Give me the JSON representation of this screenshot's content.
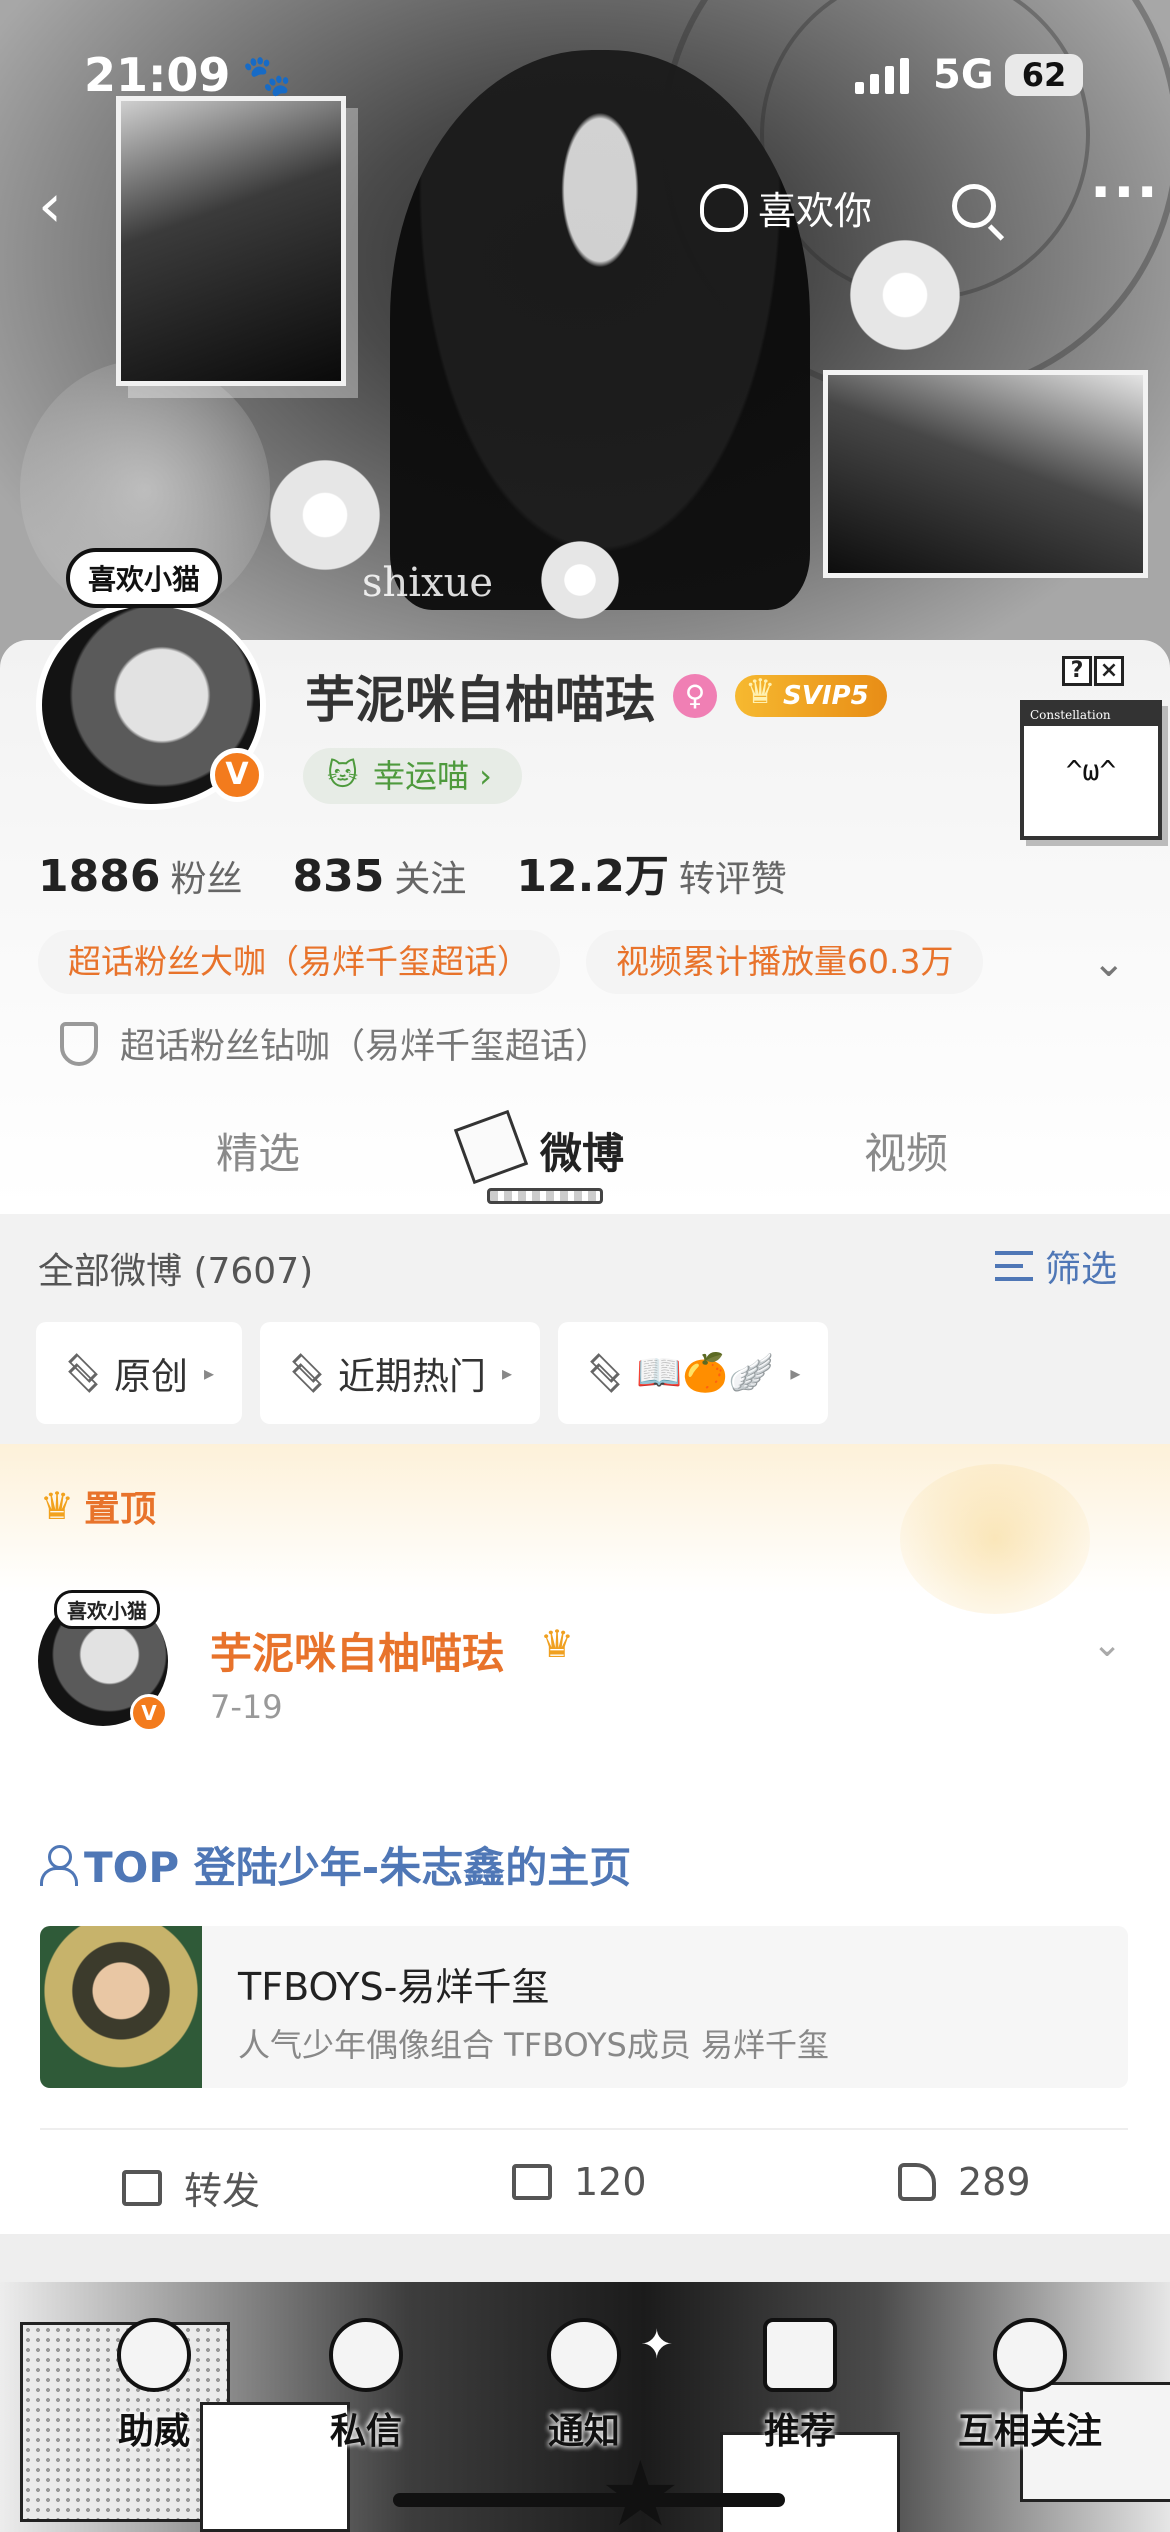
{
  "status_bar": {
    "time": "21:09",
    "network": "5G",
    "battery": "62"
  },
  "nav": {
    "like_label": "喜欢你"
  },
  "banner": {
    "watermark": "shixue"
  },
  "profile": {
    "avatar_bubble": "喜欢小猫",
    "verify_letter": "V",
    "name": "芋泥咪自柚喵珐",
    "svip_label": "SVIP5",
    "lucky_label": "幸运喵 ›",
    "widget_title": "Constellation",
    "widget_face": "^ω^",
    "stats": [
      {
        "num": "1886",
        "label": "粉丝"
      },
      {
        "num": "835",
        "label": "关注"
      },
      {
        "num": "12.2万",
        "label": "转评赞"
      }
    ],
    "tags": [
      "超话粉丝大咖（易烊千玺超话）",
      "视频累计播放量60.3万"
    ],
    "badge_line": "超话粉丝钻咖（易烊千玺超话）"
  },
  "tabs": [
    {
      "label": "精选"
    },
    {
      "label": "微博"
    },
    {
      "label": "视频"
    }
  ],
  "feed": {
    "all_count": "全部微博 (7607)",
    "filter_label": "筛选",
    "chips": [
      "原创",
      "近期热门",
      "📖🍊🪽"
    ]
  },
  "post": {
    "pinned_label": "置顶",
    "avatar_bubble": "喜欢小猫",
    "author": "芋泥咪自柚喵珐",
    "date": "7-19",
    "topic": "TOP 登陆少年-朱志鑫的主页",
    "link_title": "TFBOYS-易烊千玺",
    "link_sub": "人气少年偶像组合 TFBOYS成员 易烊千玺",
    "repost_label": "转发",
    "comment_count": "120",
    "like_count": "289"
  },
  "tabbar": {
    "items": [
      "助威",
      "私信",
      "通知",
      "推荐",
      "互相关注"
    ]
  },
  "colors": {
    "accent_orange": "#e8732b",
    "link_blue": "#4f77b6",
    "svip_gold": "#f2a21d"
  },
  "icons": [
    "back-icon",
    "like-hand-icon",
    "search-icon",
    "more-icon",
    "female-icon",
    "svip-crown-icon",
    "shield-icon",
    "filter-icon",
    "layers-icon",
    "crown-icon",
    "chevron-down-icon",
    "person-icon",
    "repost-icon",
    "comment-icon",
    "thumbs-up-icon"
  ]
}
